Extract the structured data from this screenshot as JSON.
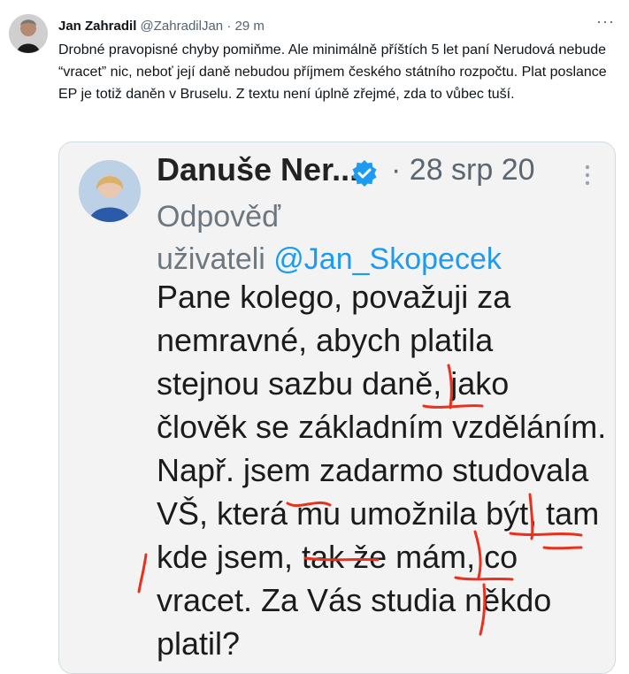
{
  "tweet": {
    "author_name": "Jan Zahradil",
    "author_handle": "@ZahradilJan",
    "separator": "·",
    "time": "29 m",
    "more_label": "···",
    "text": "Drobné pravopisné chyby pomiňme. Ale minimálně příštích 5 let paní Nerudová nebude “vracet” nic, neboť její daně nebudou příjmem českého státního rozpočtu. Plat poslance EP je totiž daněn v Bruselu. Z textu není úplně zřejmé, zda to vůbec tuší."
  },
  "screenshot": {
    "author_name": "Danuše Ner...",
    "separator": "·",
    "date": "28 srp 20",
    "reply_prefix": "Odpověď",
    "reply_to_prefix": "uživateli",
    "reply_handle": "@Jan_Skopecek",
    "lines": [
      "Pane kolego, považuji za",
      "nemravné, abych platila",
      "stejnou sazbu daně, jako",
      "člověk se základním vzděláním.",
      "Např. jsem zadarmo studovala",
      "VŠ, která mu umožnila být, tam",
      "kde jsem, tak že mám, co",
      "vracet. Za Vás studia někdo",
      "platil?"
    ]
  },
  "colors": {
    "link": "#1d9bf0",
    "muted": "#536471",
    "annotation": "#e8321f",
    "verified": "#1d9bf0"
  },
  "icons": {
    "more": "more-horizontal-icon",
    "verified": "verified-badge-icon",
    "menu": "more-vertical-icon"
  }
}
